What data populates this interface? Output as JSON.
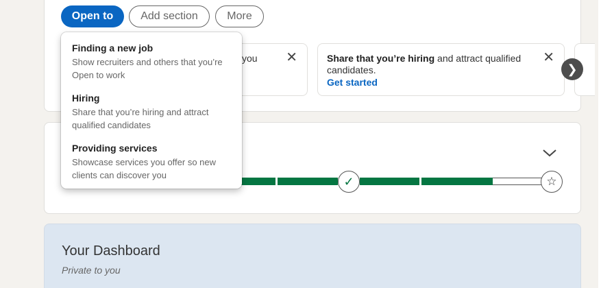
{
  "profile_actions": {
    "open_to_label": "Open to",
    "add_section_label": "Add section",
    "more_label": "More"
  },
  "suggestions": [
    {
      "visible_fragment": "you",
      "close_icon": "close-icon"
    },
    {
      "text_bold": "Share that you’re hiring",
      "text_rest": " and attract qualified candidates.",
      "link_label": "Get started",
      "close_icon": "close-icon"
    }
  ],
  "open_to_menu": {
    "items": [
      {
        "title": "Finding a new job",
        "description": "Show recruiters and others that you’re Open to work"
      },
      {
        "title": "Hiring",
        "description": "Share that you’re hiring and attract qualified candidates"
      },
      {
        "title": "Providing services",
        "description": "Showcase services you offer so new clients can discover you"
      }
    ]
  },
  "profile_strength": {
    "progress_fraction": 0.78,
    "check_icon": "check-icon",
    "star_icon": "star-icon",
    "expand_icon": "chevron-down-icon"
  },
  "dashboard": {
    "title": "Your Dashboard",
    "subtitle": "Private to you"
  },
  "colors": {
    "primary": "#0a66c2",
    "progress": "#057642",
    "dashboard_bg": "#dce6f1"
  }
}
